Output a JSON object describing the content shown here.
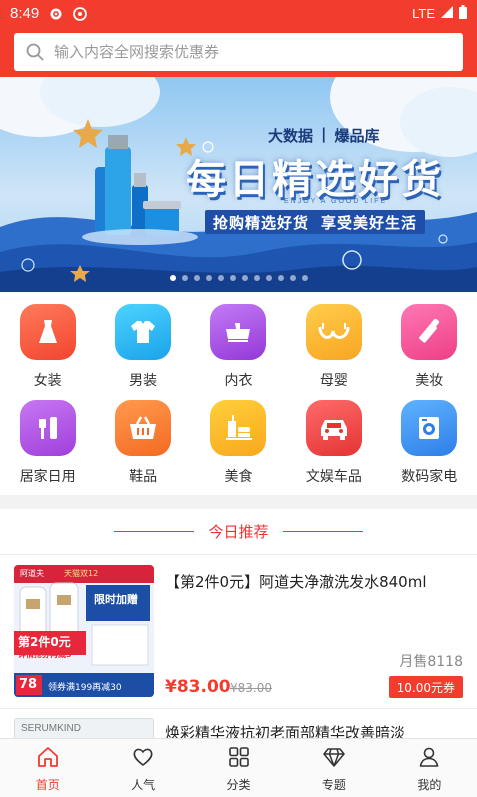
{
  "status_bar": {
    "time": "8:49",
    "network": "LTE"
  },
  "search": {
    "placeholder": "输入内容全网搜索优惠券"
  },
  "banner": {
    "subtitle_left": "大数据",
    "subtitle_sep": "|",
    "subtitle_right": "爆品库",
    "title": "每日精选好货",
    "tagline_en": "ENJOY A GOOD LIFE",
    "slogan_left": "抢购精选好货",
    "slogan_right": "享受美好生活"
  },
  "categories": [
    {
      "label": "女装",
      "icon": "dress-icon",
      "color": "#f4553e"
    },
    {
      "label": "男装",
      "icon": "shirt-icon",
      "color": "#24b6f0"
    },
    {
      "label": "内衣",
      "icon": "lingerie-icon",
      "color": "#a24de0"
    },
    {
      "label": "母婴",
      "icon": "bra-icon",
      "color": "#f8b42c"
    },
    {
      "label": "美妆",
      "icon": "lipstick-icon",
      "color": "#f2589a"
    },
    {
      "label": "居家日用",
      "icon": "brush-icon",
      "color": "#b552e0"
    },
    {
      "label": "鞋品",
      "icon": "basket-icon",
      "color": "#f47a2e"
    },
    {
      "label": "美食",
      "icon": "food-icon",
      "color": "#fbb428"
    },
    {
      "label": "文娱车品",
      "icon": "car-icon",
      "color": "#f04848"
    },
    {
      "label": "数码家电",
      "icon": "washer-icon",
      "color": "#3b8ef0"
    }
  ],
  "section_title": "今日推荐",
  "products": [
    {
      "title": "【第2件0元】阿道夫净澈洗发水840ml",
      "sold": "月售8118",
      "price": "¥83.00",
      "original_price": "¥83.00",
      "coupon": "10.00元券",
      "thumb_text": {
        "brand": "阿道夫",
        "store": "天猫双12",
        "promo_top": "限时加赠",
        "promo_main": "第2件0元",
        "promo_sub": "详情抢券再减5",
        "price_badge": "78",
        "bottom": "领券满199再减30"
      }
    },
    {
      "title": "焕彩精华液抗初老面部精华改善暗淡",
      "thumb_text": {
        "brand": "SERUMKIND"
      }
    }
  ],
  "tabbar": [
    {
      "label": "首页",
      "icon": "home-icon",
      "active": true
    },
    {
      "label": "人气",
      "icon": "heart-icon",
      "active": false
    },
    {
      "label": "分类",
      "icon": "grid-icon",
      "active": false
    },
    {
      "label": "专题",
      "icon": "diamond-icon",
      "active": false
    },
    {
      "label": "我的",
      "icon": "user-icon",
      "active": false
    }
  ],
  "colors": {
    "brand": "#f23c2e"
  }
}
